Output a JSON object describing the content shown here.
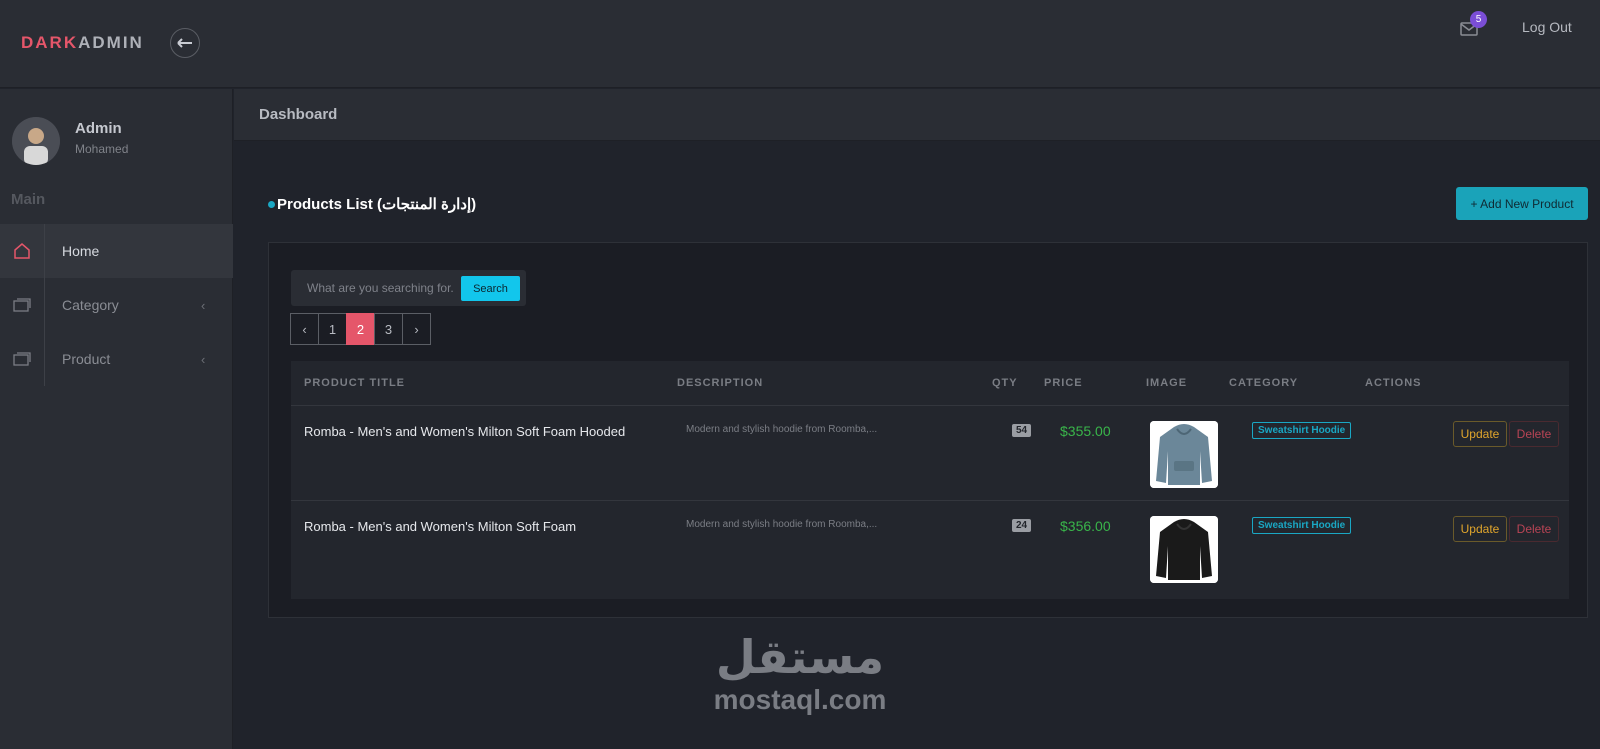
{
  "topbar": {
    "logo_part1": "DARK",
    "logo_part2": "ADMIN",
    "mail_count": "5",
    "logout_label": "Log Out"
  },
  "sidebar": {
    "user_name": "Admin",
    "user_sub": "Mohamed",
    "heading": "Main",
    "items": [
      {
        "label": "Home",
        "icon": "home-icon",
        "active": true
      },
      {
        "label": "Category",
        "icon": "window-icon",
        "active": false
      },
      {
        "label": "Product",
        "icon": "window-icon",
        "active": false
      }
    ]
  },
  "header": {
    "title": "Dashboard"
  },
  "main": {
    "section_title": "Products List (إدارة المنتجات)",
    "add_button": "+ Add New Product",
    "search": {
      "placeholder": "What are you searching for.",
      "button": "Search"
    },
    "pager": {
      "prev": "‹",
      "pages": [
        "1",
        "2",
        "3"
      ],
      "active": "2",
      "next": "›"
    },
    "table": {
      "headers": [
        "PRODUCT TITLE",
        "DESCRIPTION",
        "QTY",
        "PRICE",
        "IMAGE",
        "CATEGORY",
        "ACTIONS"
      ],
      "rows": [
        {
          "title": "Romba - Men's and Women's Milton Soft Foam Hooded",
          "description": "Modern and stylish hoodie from Roomba,...",
          "qty": "54",
          "price": "$355.00",
          "image_color": "#6b8799",
          "category": "Sweatshirt Hoodie",
          "update": "Update",
          "delete": "Delete"
        },
        {
          "title": "Romba - Men's and Women's Milton Soft Foam",
          "description": "Modern and stylish hoodie from Roomba,...",
          "qty": "24",
          "price": "$356.00",
          "image_color": "#1a1a1a",
          "category": "Sweatshirt Hoodie",
          "update": "Update",
          "delete": "Delete"
        }
      ]
    }
  },
  "watermark": {
    "arabic": "مستقل",
    "latin": "mostaql.com"
  },
  "colors": {
    "accent": "#e5566a",
    "primary": "#1aa3b9",
    "success": "#39b54a",
    "warning": "#e0a52c",
    "danger": "#b84455"
  }
}
